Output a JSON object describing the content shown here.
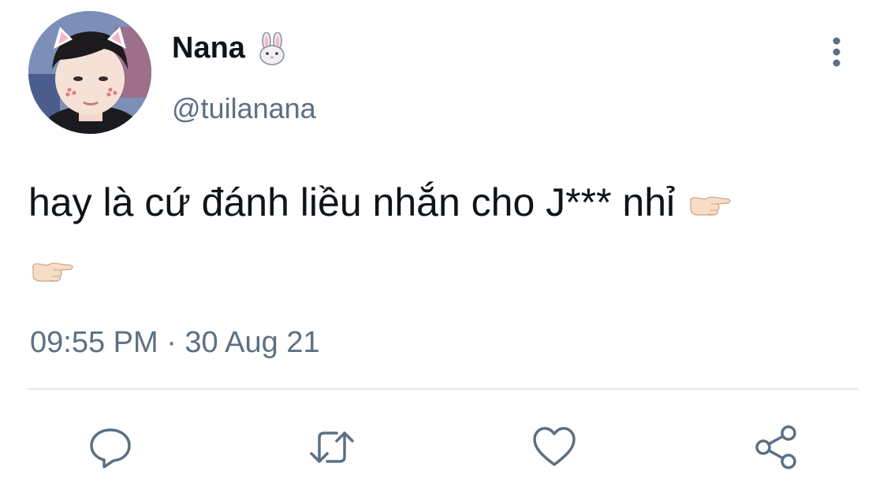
{
  "author": {
    "display_name": "Nana",
    "name_emoji": "rabbit-face-icon",
    "handle": "@tuilanana",
    "avatar": "profile-photo"
  },
  "tweet": {
    "text_line": "hay là cứ đánh liều nhắn cho J*** nhỉ",
    "trailing_emojis": [
      "backhand-index-pointing-right-icon",
      "backhand-index-pointing-right-icon"
    ],
    "timestamp": "09:55 PM · 30 Aug 21"
  },
  "actions": [
    {
      "name": "reply",
      "icon": "reply-icon"
    },
    {
      "name": "retweet",
      "icon": "retweet-icon"
    },
    {
      "name": "like",
      "icon": "heart-icon"
    },
    {
      "name": "share",
      "icon": "share-icon"
    }
  ],
  "colors": {
    "text_primary": "#0f1419",
    "text_secondary": "#5b7083",
    "divider": "#e1e6ea",
    "icon": "#5b7083"
  }
}
